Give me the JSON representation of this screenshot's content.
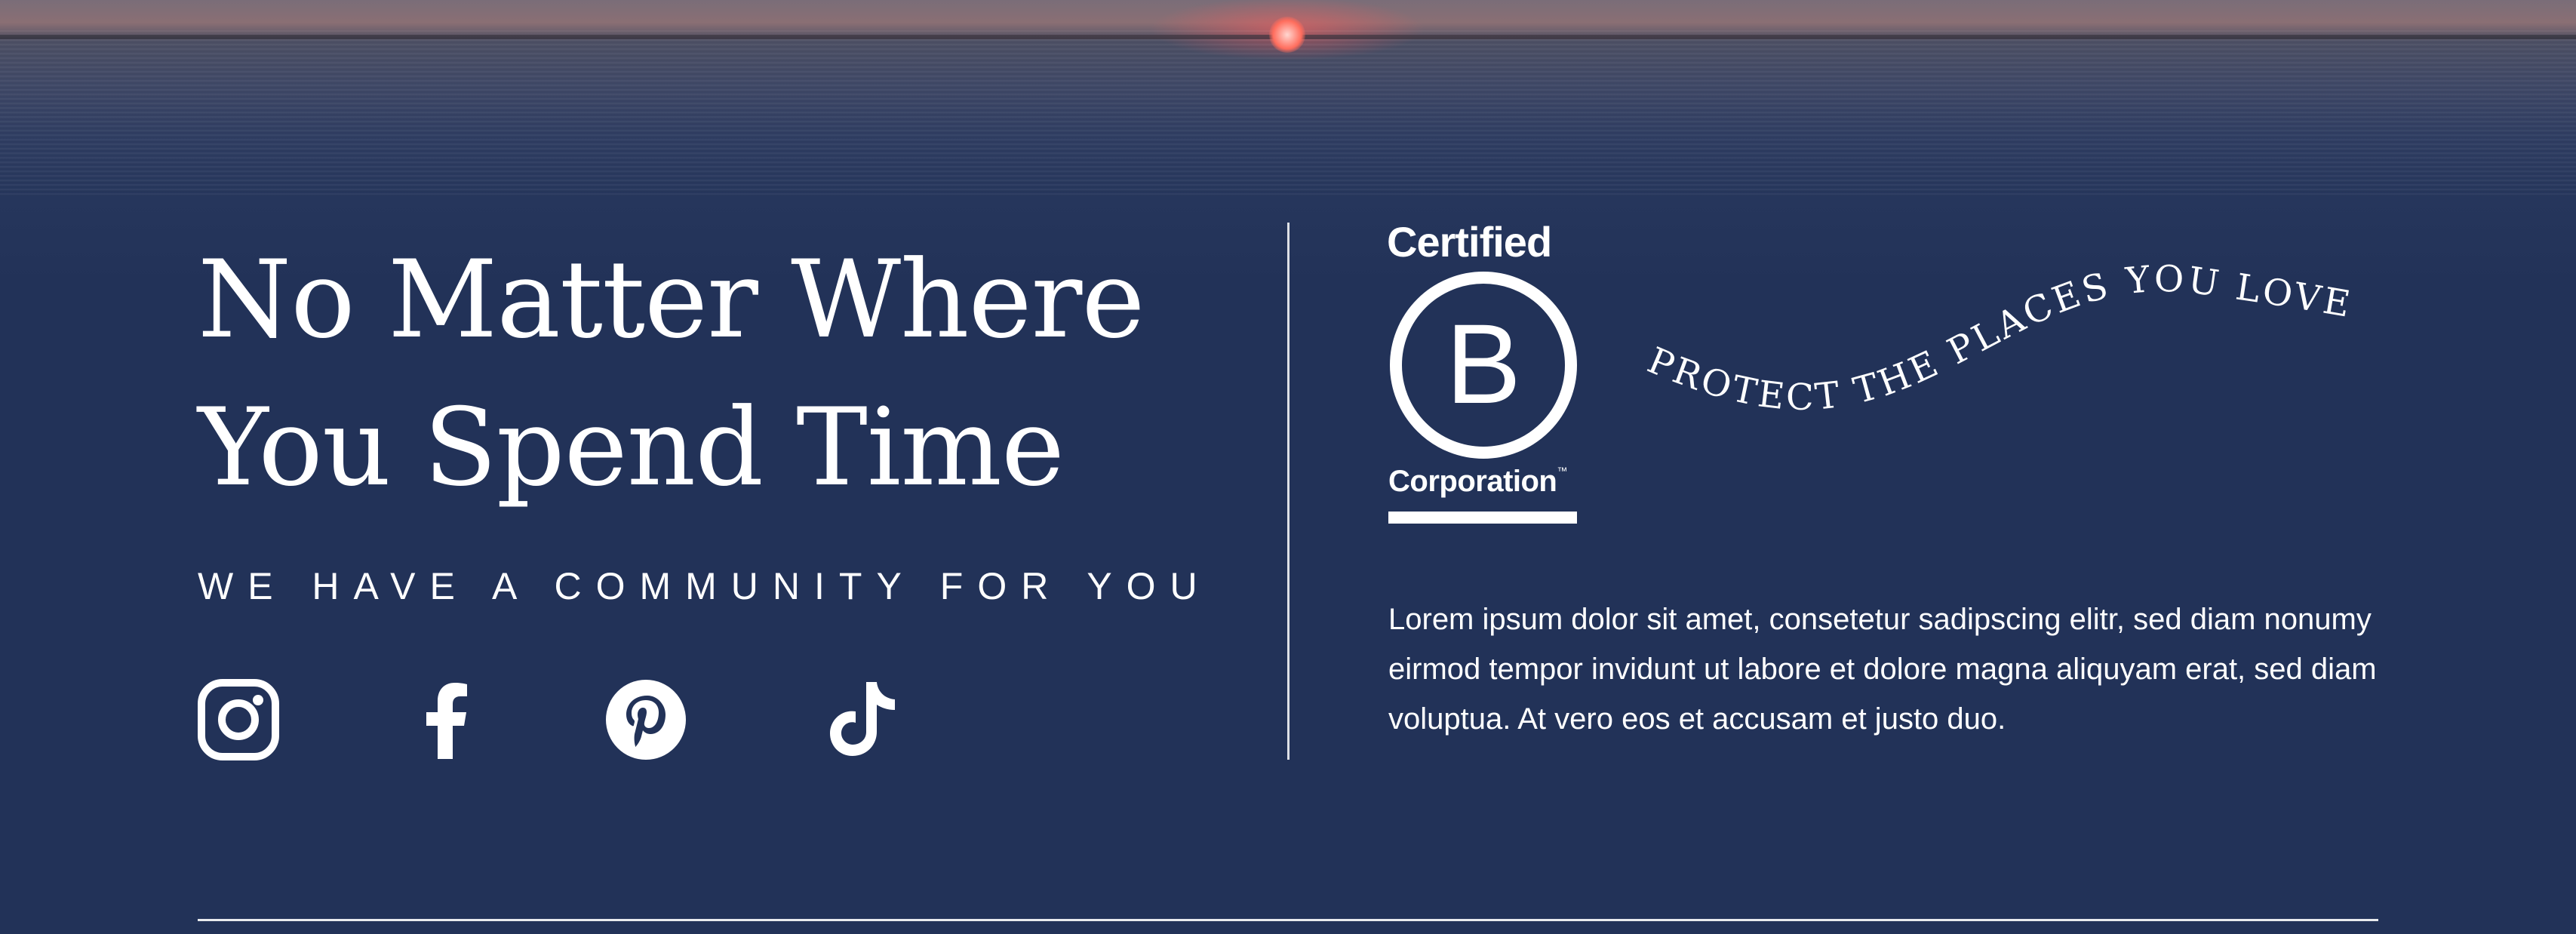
{
  "hero": {
    "heading_line1": "No Matter Where",
    "heading_line2": "You Spend Time",
    "tagline": "WE HAVE A COMMUNITY FOR YOU"
  },
  "social": {
    "items": [
      {
        "icon": "instagram-icon"
      },
      {
        "icon": "facebook-icon"
      },
      {
        "icon": "pinterest-icon"
      },
      {
        "icon": "tiktok-icon"
      }
    ]
  },
  "bcorp": {
    "certified": "Certified",
    "letter": "B",
    "corporation": "Corporation",
    "tm": "™"
  },
  "slogan": "PROTECT THE PLACES YOU LOVE",
  "body": "Lorem ipsum dolor sit amet, consetetur sadipscing elitr, sed diam nonumy eirmod tempor invidunt ut labore et dolore magna aliquyam erat, sed diam voluptua. At vero eos et accusam et justo duo.",
  "colors": {
    "background": "#223258",
    "text": "#ffffff",
    "sun": "#ff6d5d"
  }
}
